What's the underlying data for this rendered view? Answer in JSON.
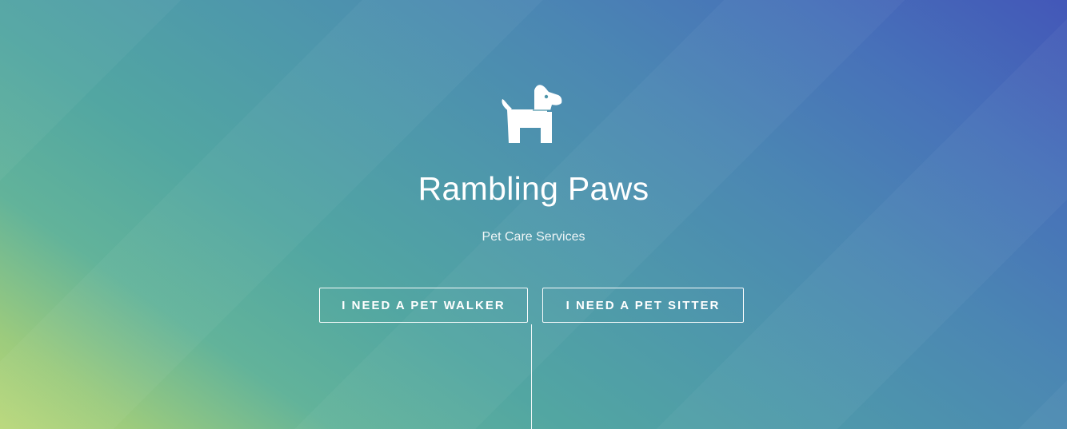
{
  "hero": {
    "logo_icon": "dog-icon",
    "title": "Rambling Paws",
    "subtitle": "Pet Care Services",
    "buttons": {
      "walker_label": "I NEED A PET WALKER",
      "sitter_label": "I NEED A PET SITTER"
    }
  },
  "colors": {
    "gradient_start": "#b9d87a",
    "gradient_mid": "#52a6a2",
    "gradient_end": "#4357b8",
    "text": "#ffffff"
  }
}
